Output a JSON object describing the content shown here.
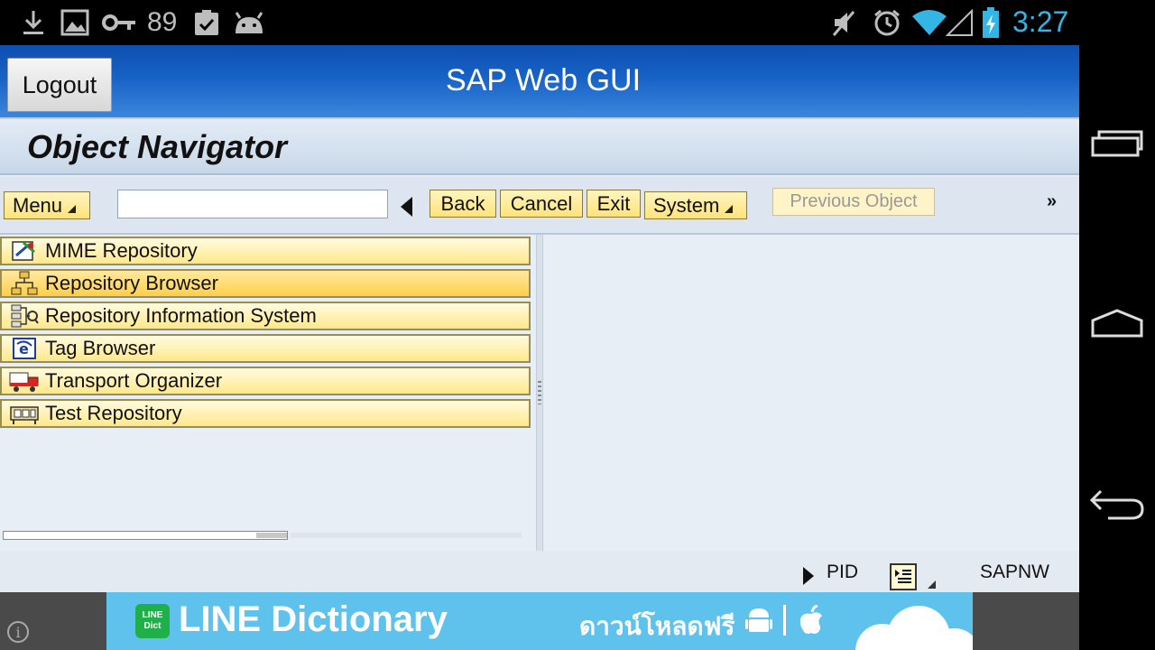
{
  "status_bar": {
    "notification_count": "89",
    "time": "3:27",
    "icons": [
      "download-icon",
      "image-icon",
      "key-icon",
      "clipboard-check-icon",
      "android-icon",
      "mute-icon",
      "alarm-icon",
      "wifi-icon",
      "signal-icon",
      "battery-charging-icon"
    ]
  },
  "app": {
    "title": "SAP Web GUI",
    "logout_label": "Logout",
    "page_title": "Object Navigator"
  },
  "toolbar": {
    "menu_label": "Menu",
    "command_value": "",
    "back_label": "Back",
    "cancel_label": "Cancel",
    "exit_label": "Exit",
    "system_label": "System",
    "previous_object_label": "Previous Object",
    "more_label": "»"
  },
  "navigator": {
    "items": [
      {
        "label": "MIME Repository",
        "icon": "mime-repository-icon",
        "selected": false
      },
      {
        "label": "Repository Browser",
        "icon": "repository-browser-icon",
        "selected": true
      },
      {
        "label": "Repository Information System",
        "icon": "repository-info-system-icon",
        "selected": false
      },
      {
        "label": "Tag Browser",
        "icon": "tag-browser-icon",
        "selected": false
      },
      {
        "label": "Transport Organizer",
        "icon": "transport-organizer-icon",
        "selected": false
      },
      {
        "label": "Test Repository",
        "icon": "test-repository-icon",
        "selected": false
      }
    ]
  },
  "sap_status": {
    "pid_label": "PID",
    "system_label": "SAPNW"
  },
  "ad": {
    "logo_text": "LINE Dict",
    "title": "LINE Dictionary",
    "thai_text": "ดาวน์โหลดฟรี",
    "info_icon": "i"
  },
  "colors": {
    "title_blue": "#1762c6",
    "time_blue": "#33b5e5",
    "button_yellow": "#ffe27a",
    "ad_blue": "#5fc2ec"
  }
}
